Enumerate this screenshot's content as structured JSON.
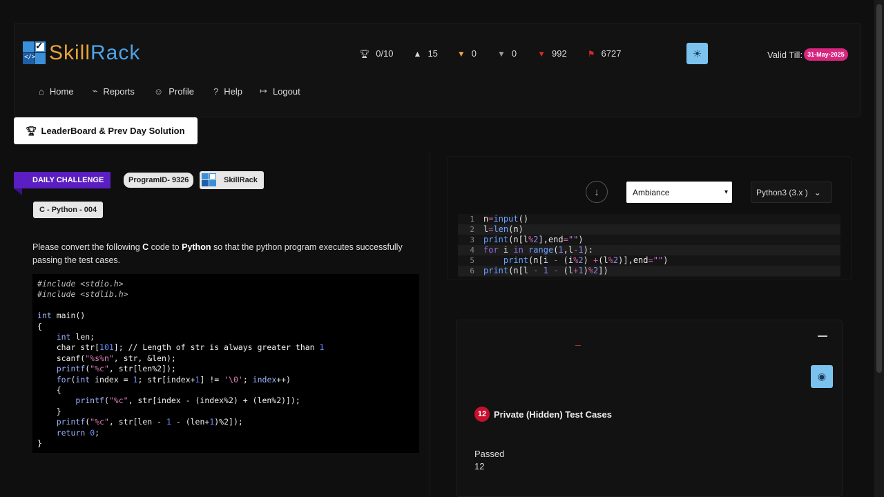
{
  "header": {
    "logo_skill": "Skill",
    "logo_rack": "Rack",
    "logo_code": "</>",
    "stats": [
      {
        "icon": "trophy-icon",
        "value": "0/10"
      },
      {
        "icon": "graduation-cap-icon",
        "value": "15"
      },
      {
        "icon": "gold-medal-icon",
        "value": "0"
      },
      {
        "icon": "silver-medal-icon",
        "value": "0"
      },
      {
        "icon": "red-medal-icon",
        "value": "992"
      },
      {
        "icon": "flag-icon",
        "value": "6727"
      }
    ],
    "valid_till_label": "Valid Till:",
    "valid_till_date": "31-May-2025"
  },
  "nav": [
    {
      "label": "Home",
      "icon": "home-icon"
    },
    {
      "label": "Reports",
      "icon": "chart-icon"
    },
    {
      "label": "Profile",
      "icon": "user-icon"
    },
    {
      "label": "Help",
      "icon": "question-icon"
    },
    {
      "label": "Logout",
      "icon": "logout-icon"
    }
  ],
  "leaderboard_button": "LeaderBoard & Prev Day Solution",
  "problem": {
    "daily_label": "DAILY CHALLENGE",
    "program_id": "ProgramID- 9326",
    "source": "SkillRack",
    "language_tag": "C - Python - 004",
    "desc_1": "Please convert the following ",
    "desc_c": "C",
    "desc_2": " code to ",
    "desc_py": "Python",
    "desc_3": " so that the python program executes successfully passing the test cases."
  },
  "editor": {
    "theme_value": "Ambiance",
    "language_value": "Python3 (3.x )"
  },
  "results": {
    "testcase_count": "12",
    "testcase_label": "Private (Hidden) Test Cases",
    "passed_label": "Passed",
    "passed_value": "12"
  },
  "colors": {
    "accent_blue": "#7cc2ef",
    "daily_purple": "#5b1ec2",
    "badge_pink": "#d8267f",
    "badge_red": "#c8102e"
  }
}
